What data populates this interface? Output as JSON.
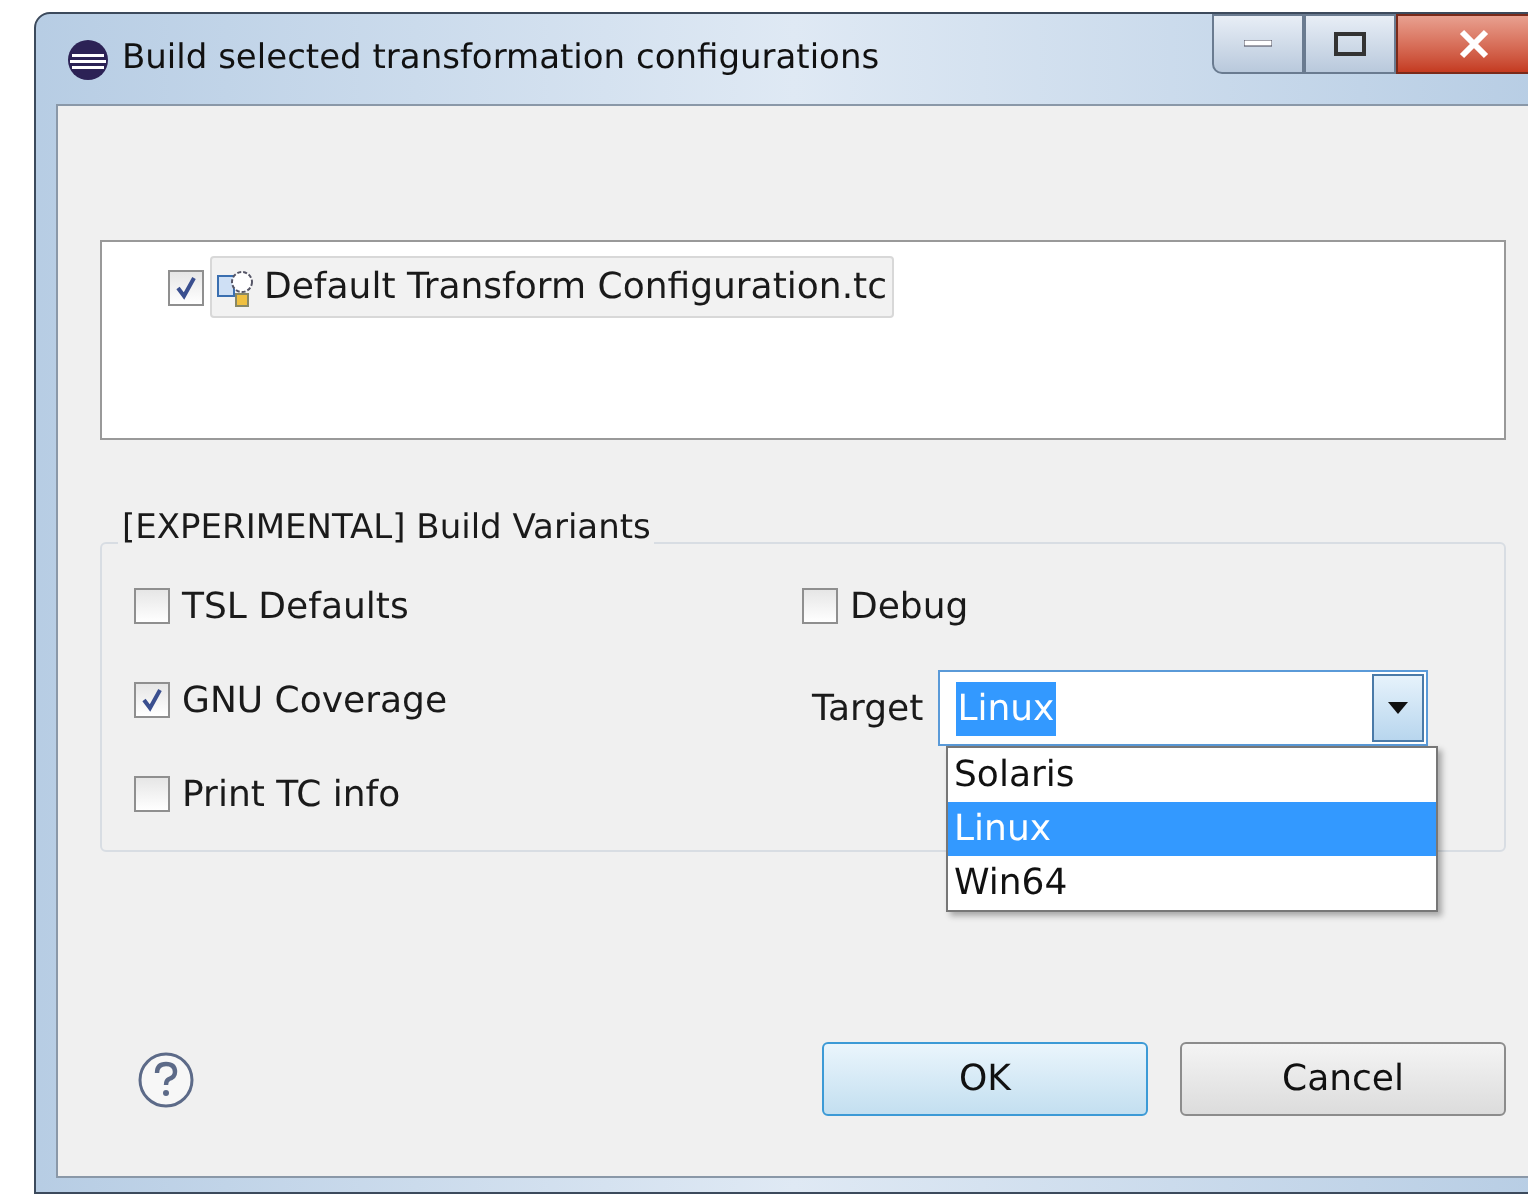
{
  "window": {
    "title": "Build selected transformation configurations"
  },
  "configurations": [
    {
      "label": "Default Transform Configuration.tc",
      "checked": true
    }
  ],
  "build_variants": {
    "title": "[EXPERIMENTAL] Build Variants",
    "options": [
      {
        "label": "TSL Defaults",
        "checked": false
      },
      {
        "label": "GNU Coverage",
        "checked": true
      },
      {
        "label": "Print TC info",
        "checked": false
      },
      {
        "label": "Debug",
        "checked": false
      }
    ],
    "target": {
      "label": "Target",
      "value": "Linux",
      "options": [
        {
          "label": "Solaris",
          "selected": false
        },
        {
          "label": "Linux",
          "selected": true
        },
        {
          "label": "Win64",
          "selected": false
        }
      ]
    }
  },
  "buttons": [
    {
      "label": "OK",
      "kind": "default"
    },
    {
      "label": "Cancel",
      "kind": "normal"
    }
  ]
}
